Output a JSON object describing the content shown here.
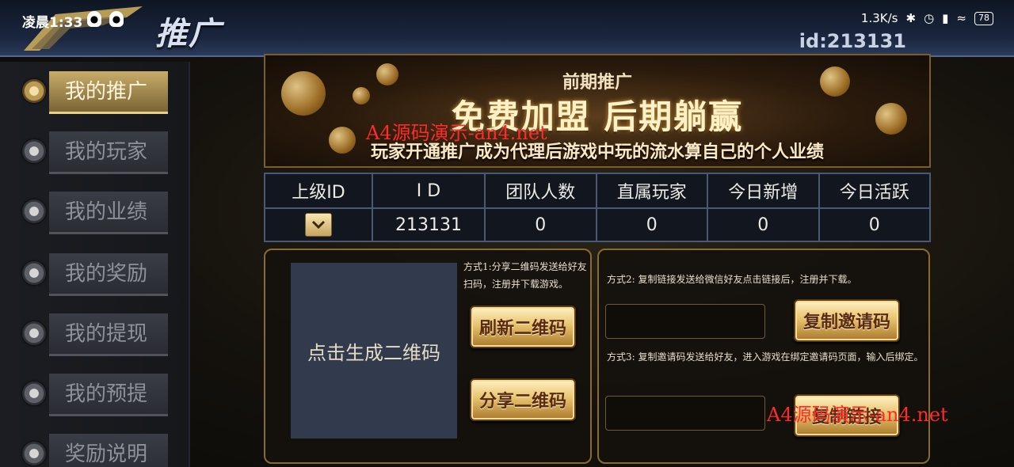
{
  "status_bar": {
    "time": "凌晨1:33",
    "net_speed": "1.3K/s",
    "battery": "78"
  },
  "header": {
    "title": "推广",
    "user_id": "id:213131"
  },
  "sidebar": {
    "items": [
      {
        "label": "我的推广",
        "active": true
      },
      {
        "label": "我的玩家",
        "active": false
      },
      {
        "label": "我的业绩",
        "active": false
      },
      {
        "label": "我的奖励",
        "active": false
      },
      {
        "label": "我的提现",
        "active": false
      },
      {
        "label": "我的预提",
        "active": false
      },
      {
        "label": "奖励说明",
        "active": false
      }
    ]
  },
  "banner": {
    "subtitle": "前期推广",
    "headline": "免费加盟 后期躺赢",
    "description": "玩家开通推广成为代理后游戏中玩的流水算自己的个人业绩"
  },
  "watermarks": [
    "A4源码演示-an4.net",
    "A4源码演示-an4.net"
  ],
  "stats": {
    "headers": [
      "上级ID",
      "I D",
      "团队人数",
      "直属玩家",
      "今日新增",
      "今日活跃"
    ],
    "values": [
      "",
      "213131",
      "0",
      "0",
      "0",
      "0"
    ]
  },
  "share_panel": {
    "qr_placeholder": "点击生成二维码",
    "method1": "方式1:分享二维码发送给好友扫码，注册并下载游戏。",
    "refresh_qr": "刷新二维码",
    "share_qr": "分享二维码"
  },
  "invite_panel": {
    "method2": "方式2: 复制链接发送给微信好友点击链接后，注册并下载。",
    "copy_invite": "复制邀请码",
    "method3": "方式3: 复制邀请码发送给好友，进入游戏在绑定邀请码页面，输入后绑定。",
    "copy_link": "复制链接"
  },
  "colors": {
    "gold": "#e8c46e",
    "nav_active": "#c8ac6a",
    "table_border": "#4b5874",
    "qr_bg": "#323a4d",
    "watermark": "#ff2a2a"
  }
}
